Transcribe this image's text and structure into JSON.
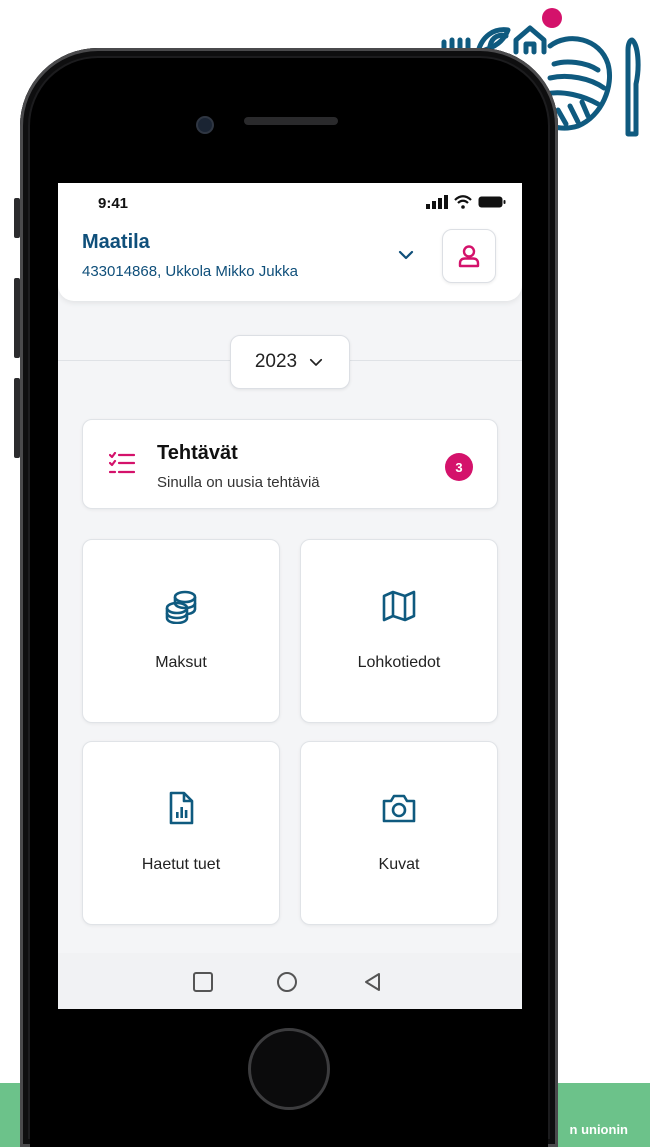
{
  "status": {
    "time": "9:41"
  },
  "header": {
    "title": "Maatila",
    "subtitle": "433014868, Ukkola Mikko Jukka"
  },
  "year": {
    "selected": "2023"
  },
  "tasks": {
    "title": "Tehtävät",
    "subtitle": "Sinulla on uusia tehtäviä",
    "count": "3"
  },
  "tiles": [
    {
      "label": "Maksut",
      "icon": "coins-icon"
    },
    {
      "label": "Lohkotiedot",
      "icon": "map-icon"
    },
    {
      "label": "Haetut tuet",
      "icon": "document-chart-icon"
    },
    {
      "label": "Kuvat",
      "icon": "camera-icon"
    }
  ],
  "nav": {
    "buttons": [
      "recents-icon",
      "home-icon",
      "back-icon"
    ]
  },
  "footer": {
    "caption": "n unionin"
  },
  "colors": {
    "primary": "#0f4f7a",
    "accent": "#d4126b",
    "tile_icon": "#0f5a7f",
    "band": "#6cc28a"
  }
}
